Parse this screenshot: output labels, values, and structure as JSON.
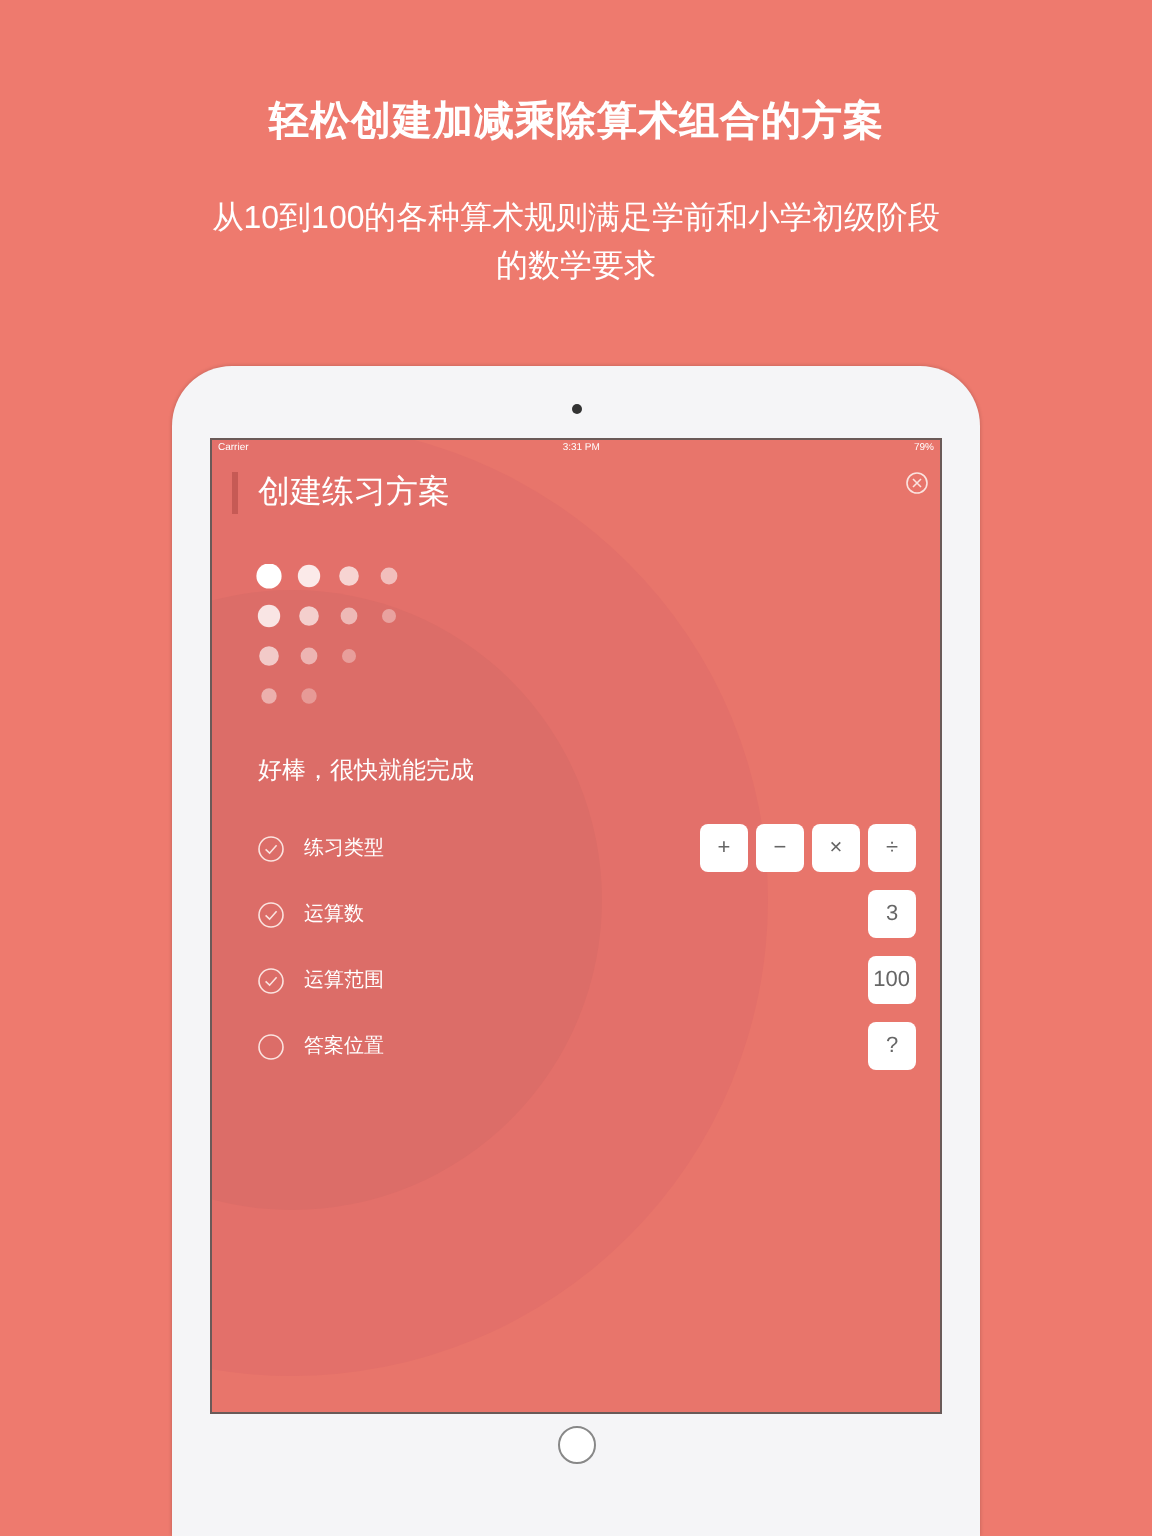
{
  "headline": "轻松创建加减乘除算术组合的方案",
  "subheadline": "从10到100的各种算术规则满足学前和小学初级阶段的数学要求",
  "status_bar": {
    "carrier": "Carrier",
    "time": "3:31 PM",
    "battery": "79%"
  },
  "screen": {
    "title": "创建练习方案",
    "message": "好棒，很快就能完成",
    "settings": [
      {
        "label": "练习类型",
        "checked": true,
        "options": [
          "+",
          "−",
          "×",
          "÷"
        ]
      },
      {
        "label": "运算数",
        "checked": true,
        "options": [
          "3"
        ]
      },
      {
        "label": "运算范围",
        "checked": true,
        "options": [
          "100"
        ]
      },
      {
        "label": "答案位置",
        "checked": false,
        "options": [
          "?"
        ]
      }
    ]
  }
}
